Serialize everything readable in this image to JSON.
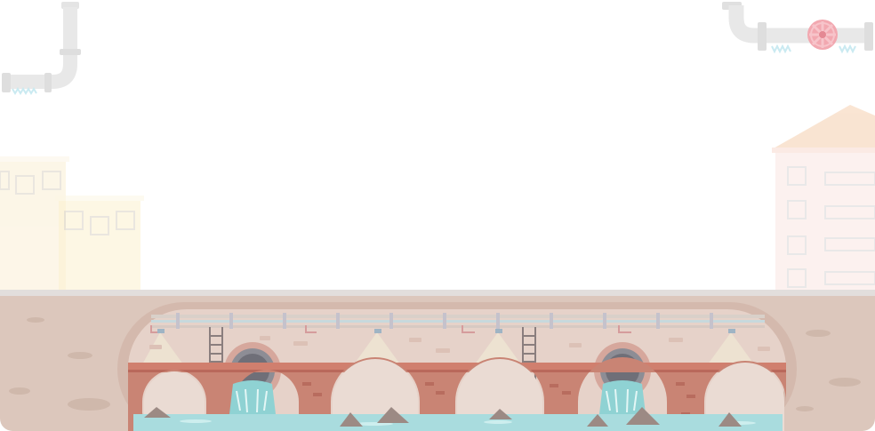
{
  "scene": {
    "palette": {
      "sky": "#ffffff",
      "ground": "#d9c3b8",
      "ground_dark": "#cbb2a6",
      "road": "#e4e0de",
      "tunnel_wall": "#e3cdc4",
      "brick": "#c98a7c",
      "brick_dark": "#b5766a",
      "water": "#b7e3e4",
      "water_light": "#d4f1f0",
      "pipe": "#d6d6d6",
      "pipe_shade": "#bdbdbd",
      "valve": "#ec8e98",
      "building_left": "#fbf0da",
      "building_right": "#fbe7e4",
      "roof": "#f6d8c5",
      "window": "#e9eef2"
    },
    "icons": [
      "pipe-icon",
      "valve-wheel-icon",
      "ladder-icon",
      "drain-outlet-icon",
      "rock-icon",
      "lamp-icon"
    ]
  }
}
